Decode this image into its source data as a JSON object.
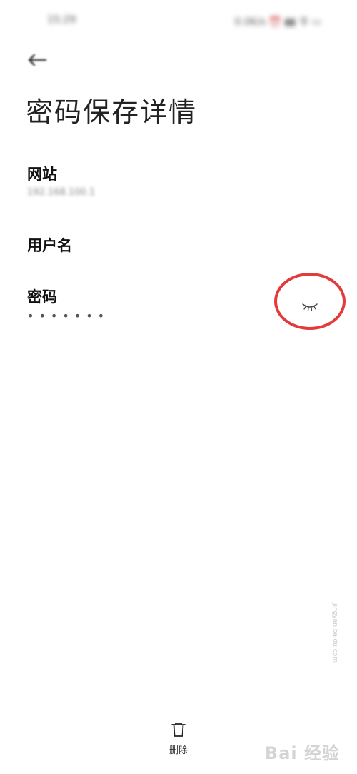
{
  "status_bar": {
    "time": "15:29",
    "icons": "0.0K/s ⏰ ▮▮ 令 ▭"
  },
  "header": {
    "title": "密码保存详情"
  },
  "fields": {
    "website": {
      "label": "网站",
      "value": "192.168.100.1"
    },
    "username": {
      "label": "用户名",
      "value": ""
    },
    "password": {
      "label": "密码",
      "value": "•••••••"
    }
  },
  "actions": {
    "delete_label": "删除"
  },
  "icons": {
    "back": "arrow-left-icon",
    "eye": "eye-closed-icon",
    "delete": "trash-icon"
  },
  "colors": {
    "annotation": "#e23b3b"
  },
  "watermark": {
    "text": "Bai 经验",
    "url": "jingyan.baidu.com"
  }
}
